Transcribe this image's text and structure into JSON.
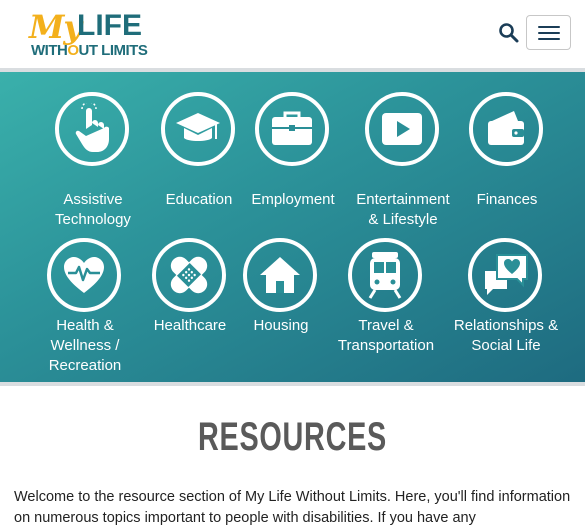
{
  "header": {
    "logo_my": "My",
    "logo_life": "LIFE",
    "logo_without_pre": "WITH",
    "logo_without_o": "O",
    "logo_without_post": "UT LIMITS"
  },
  "categories": [
    {
      "label": "Assistive\nTechnology",
      "icon": "hand-pointer-icon"
    },
    {
      "label": "Education",
      "icon": "graduation-cap-icon"
    },
    {
      "label": "Employment",
      "icon": "briefcase-icon"
    },
    {
      "label": "Entertainment\n& Lifestyle",
      "icon": "play-button-icon"
    },
    {
      "label": "Finances",
      "icon": "wallet-icon"
    },
    {
      "label": "Health &\nWellness /\nRecreation",
      "icon": "heart-pulse-icon"
    },
    {
      "label": "Healthcare",
      "icon": "bandage-icon"
    },
    {
      "label": "Housing",
      "icon": "house-icon"
    },
    {
      "label": "Travel &\nTransportation",
      "icon": "train-icon"
    },
    {
      "label": "Relationships &\nSocial Life",
      "icon": "chat-heart-icon"
    }
  ],
  "main": {
    "title": "RESOURCES",
    "intro": "Welcome to the resource section of My Life Without Limits. Here, you'll find information on numerous topics important to people with disabilities. If you have any"
  },
  "colors": {
    "brand_teal": "#1f6d7a",
    "brand_gold": "#f3b01c",
    "band_start": "#3ab0ab",
    "band_end": "#1e6b80"
  }
}
